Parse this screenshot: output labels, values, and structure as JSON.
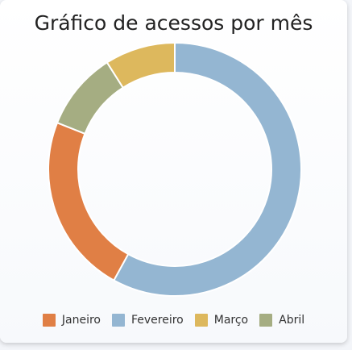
{
  "chart_data": {
    "type": "pie",
    "title": "Gráfico de acessos por mês",
    "donut": true,
    "legend_position": "bottom",
    "categories": [
      "Janeiro",
      "Fevereiro",
      "Março",
      "Abril"
    ],
    "values": [
      23,
      58,
      9,
      10
    ],
    "colors": [
      "#e07f45",
      "#94b6d2",
      "#ddb85d",
      "#a5ad82"
    ]
  }
}
